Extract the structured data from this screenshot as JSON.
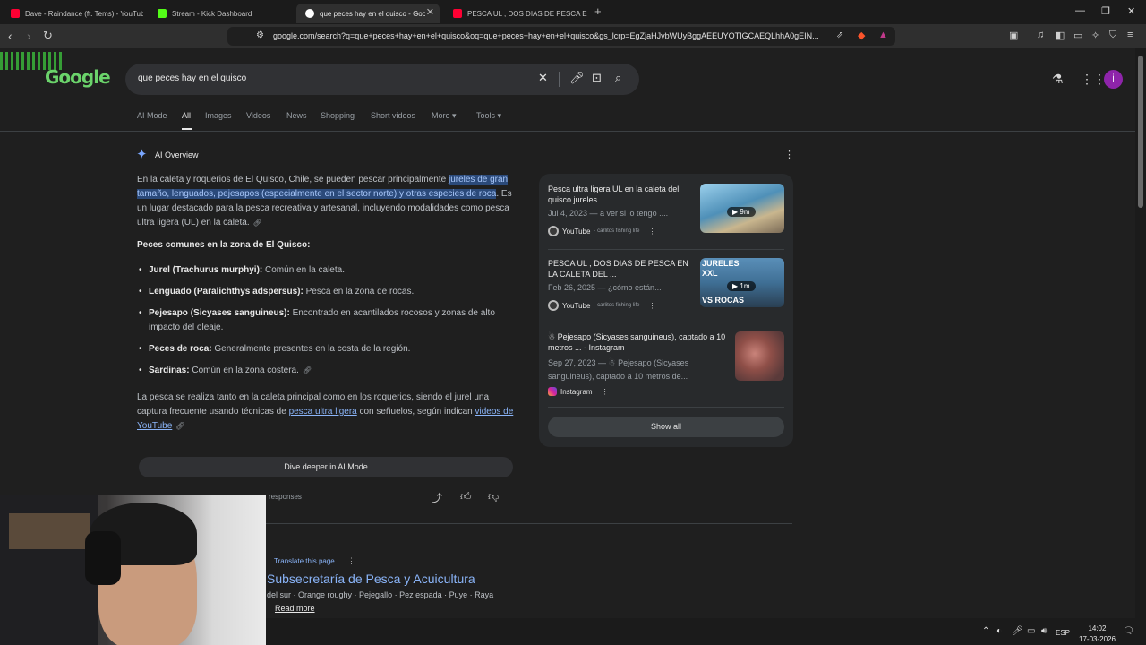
{
  "browser": {
    "tabs": [
      {
        "title": "Dave - Raindance (ft. Tems) - YouTube",
        "favicon": "youtube-icon",
        "color": "#ff0033"
      },
      {
        "title": "Stream - Kick Dashboard",
        "favicon": "kick-icon",
        "color": "#53fc18"
      },
      {
        "title": "que peces hay en el quisco - Goo",
        "favicon": "google-icon",
        "color": "#ffffff"
      },
      {
        "title": "PESCA UL , DOS DIAS DE PESCA EN L",
        "favicon": "youtube-icon",
        "color": "#ff0033"
      }
    ],
    "new_tab": "+",
    "url": "google.com/search?q=que+peces+hay+en+el+quisco&oq=que+peces+hay+en+el+quisco&gs_lcrp=EgZjaHJvbWUyBggAEEUYOTIGCAEQLhhA0gEIN..."
  },
  "google": {
    "logo": "Google",
    "query": "que peces hay en el quisco",
    "tabs": [
      "AI Mode",
      "All",
      "Images",
      "Videos",
      "News",
      "Shopping",
      "Short videos",
      "More",
      "Tools"
    ],
    "active_tab": "All",
    "avatar": "j"
  },
  "overview": {
    "title": "AI Overview",
    "intro_1": "En la caleta y roquerios de El Quisco, Chile, se pueden pescar principalmente ",
    "intro_hl": "jureles de gran tamaño, lenguados, pejesapos (especialmente en el sector norte) y otras especies de roca",
    "intro_2": ". Es un lugar destacado para la pesca recreativa y artesanal, incluyendo modalidades como pesca ultra ligera (UL) en la caleta.",
    "heading": "Peces comunes en la zona de El Quisco:",
    "fish": [
      {
        "name": "Jurel (Trachurus murphyi):",
        "desc": " Común en la caleta."
      },
      {
        "name": "Lenguado (Paralichthys adspersus):",
        "desc": " Pesca en la zona de rocas."
      },
      {
        "name": "Pejesapo (Sicyases sanguineus):",
        "desc": " Encontrado en acantilados rocosos y zonas de alto impacto del oleaje."
      },
      {
        "name": "Peces de roca:",
        "desc": " Generalmente presentes en la costa de la región."
      },
      {
        "name": "Sardinas:",
        "desc": " Común en la zona costera."
      }
    ],
    "para2_a": "La pesca se realiza tanto en la caleta principal como en los roquerios, siendo el jurel una captura frecuente usando técnicas de ",
    "para2_link1": "pesca ultra ligera",
    "para2_b": " con señuelos, según indican ",
    "para2_link2": "videos de YouTube",
    "dive_button": "Dive deeper in AI Mode",
    "responses_text": "responses"
  },
  "sources": [
    {
      "title": "Pesca ultra ligera UL en la caleta del quisco jureles",
      "date": "Jul 4, 2023 — a ver si lo tengo ....",
      "site": "YouTube",
      "channel": "· carlitos fishing life",
      "duration": "9m"
    },
    {
      "title": "PESCA UL , DOS DIAS DE PESCA EN LA CALETA DEL ...",
      "date": "Feb 26, 2025 — ¿cómo están...",
      "site": "YouTube",
      "channel": "· carlitos fishing life",
      "duration": "1m"
    },
    {
      "title": "☃ Pejesapo (Sicyases sanguineus), captado a 10 metros ... - Instagram",
      "date": "Sep 27, 2023 — ☃ Pejesapo (Sicyases sanguineus), captado a 10 metros de...",
      "site": "Instagram"
    }
  ],
  "show_all": "Show all",
  "thumb_text": [
    "JURELES",
    "XXL",
    "VS ROCAS"
  ],
  "result": {
    "translate": "Translate this page",
    "title": "Subsecretaría de Pesca y Acuicultura",
    "snippet": "del sur · Orange roughy · Pejegallo · Pez espada · Puye · Raya",
    "read_more": "Read more"
  },
  "taskbar": {
    "lang": "ESP",
    "time": "14:02",
    "date": "17-03-2026"
  }
}
